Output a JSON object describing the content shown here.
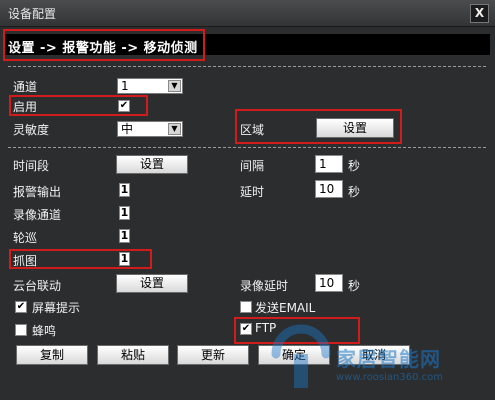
{
  "window": {
    "title": "设备配置",
    "close_symbol": "X"
  },
  "breadcrumb": "设置 -> 报警功能 -> 移动侦测",
  "form": {
    "channel": {
      "label": "通道",
      "value": "1"
    },
    "enable": {
      "label": "启用",
      "checked": true
    },
    "sensitivity": {
      "label": "灵敏度",
      "value": "中"
    },
    "region": {
      "label": "区域",
      "button": "设置"
    },
    "period": {
      "label": "时间段",
      "button": "设置"
    },
    "interval": {
      "label": "间隔",
      "value": "1",
      "unit": "秒"
    },
    "alarm_output": {
      "label": "报警输出",
      "value": "1"
    },
    "delay": {
      "label": "延时",
      "value": "10",
      "unit": "秒"
    },
    "record_channel": {
      "label": "录像通道",
      "value": "1"
    },
    "tour": {
      "label": "轮巡",
      "value": "1"
    },
    "snapshot": {
      "label": "抓图",
      "value": "1"
    },
    "ptz": {
      "label": "云台联动",
      "button": "设置"
    },
    "record_delay": {
      "label": "录像延时",
      "value": "10",
      "unit": "秒"
    },
    "screen_tip": {
      "label": "屏幕提示",
      "checked": true
    },
    "send_email": {
      "label": "发送EMAIL",
      "checked": false
    },
    "buzzer": {
      "label": "蜂鸣",
      "checked": false
    },
    "ftp": {
      "label": "FTP",
      "checked": true
    }
  },
  "buttons": {
    "copy": "复制",
    "paste": "粘贴",
    "refresh": "更新",
    "ok": "确定",
    "cancel": "取消"
  },
  "watermark": {
    "text": "家居智能网",
    "url": "www.roosian360.com"
  },
  "colors": {
    "highlight": "#d21c1c",
    "background": "#2b2d2f",
    "watermark": "#1e78c8"
  }
}
